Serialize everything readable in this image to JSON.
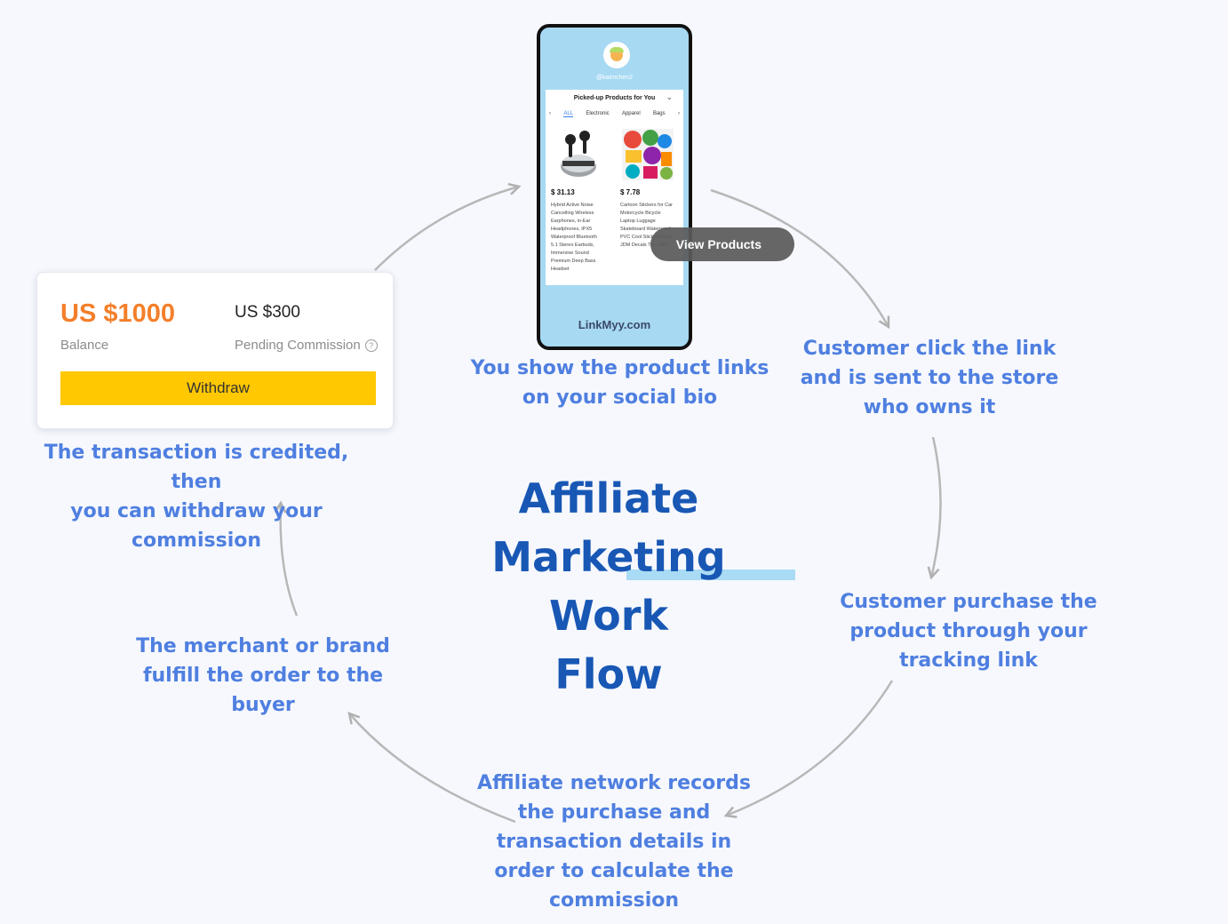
{
  "title": "Affiliate\nMarketing Work\nFlow",
  "steps": {
    "show_links": "You show the product links\non your social bio",
    "customer_click": "Customer click the link\nand is sent to the store\nwho owns it",
    "customer_purchase": "Customer purchase the\nproduct through your\ntracking link",
    "network_records": "Affiliate network records\nthe purchase and\ntransaction details in\norder to calculate the\ncommission",
    "merchant_fulfill": "The merchant or  brand\nfulfill the order to the\nbuyer",
    "credited": "The transaction is credited, then\nyou can withdraw your\ncommission"
  },
  "balance_card": {
    "balance_amount": "US $1000",
    "balance_label": "Balance",
    "pending_amount": "US $300",
    "pending_label": "Pending Commission",
    "info_icon": "?",
    "withdraw_label": "Withdraw"
  },
  "phone": {
    "username": "@kaimchen2",
    "section_title": "Picked-up Products for You",
    "tabs": [
      "ALL",
      "Electronic",
      "Apparel",
      "Bags"
    ],
    "products": [
      {
        "price": "$ 31.13",
        "description": "Hybrid Active Noise\nCancelling Wireless\nEarphones, in-Ear\nHeadphones, IPX5\nWaterproof Bluetooth\n5.1 Stereo Earbuds,\nImmersive Sound\nPremium Deep Bass\nHeadset"
      },
      {
        "price": "$ 7.78",
        "description": "Cartoon Stickers for Car\nMotorcycle Bicycle\nLaptop Luggage\nSkateboard Waterproof\nPVC Cool Sticker Bomb\nJDM Decals Toy Gifts"
      }
    ],
    "logo": "LinkMyy.com",
    "view_products_label": "View Products"
  },
  "colors": {
    "step_text": "#4f7fe0",
    "title": "#1857b4",
    "balance_amount": "#f47f2a",
    "withdraw_button": "#ffc800",
    "phone_background": "#a7d9f3",
    "arrow": "#b0b0b0"
  }
}
